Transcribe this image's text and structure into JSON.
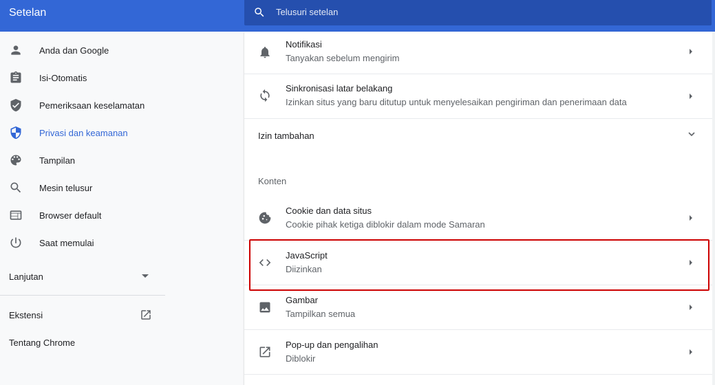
{
  "header": {
    "title": "Setelan",
    "search_placeholder": "Telusuri setelan"
  },
  "sidebar": {
    "items": [
      {
        "label": "Anda dan Google",
        "icon": "person-icon"
      },
      {
        "label": "Isi-Otomatis",
        "icon": "clipboard-icon"
      },
      {
        "label": "Pemeriksaan keselamatan",
        "icon": "shield-check-icon"
      },
      {
        "label": "Privasi dan keamanan",
        "icon": "shield-half-icon",
        "active": true
      },
      {
        "label": "Tampilan",
        "icon": "palette-icon"
      },
      {
        "label": "Mesin telusur",
        "icon": "search-icon"
      },
      {
        "label": "Browser default",
        "icon": "browser-window-icon"
      },
      {
        "label": "Saat memulai",
        "icon": "power-icon"
      }
    ],
    "advanced_label": "Lanjutan",
    "extensions_label": "Ekstensi",
    "about_label": "Tentang Chrome"
  },
  "main": {
    "rows_top": [
      {
        "title": "Notifikasi",
        "subtitle": "Tanyakan sebelum mengirim",
        "icon": "bell-icon"
      },
      {
        "title": "Sinkronisasi latar belakang",
        "subtitle": "Izinkan situs yang baru ditutup untuk menyelesaikan pengiriman dan penerimaan data",
        "icon": "sync-icon"
      }
    ],
    "additional_permissions_label": "Izin tambahan",
    "content_heading": "Konten",
    "content_rows": [
      {
        "title": "Cookie dan data situs",
        "subtitle": "Cookie pihak ketiga diblokir dalam mode Samaran",
        "icon": "cookie-icon"
      },
      {
        "title": "JavaScript",
        "subtitle": "Diizinkan",
        "icon": "code-brackets-icon"
      },
      {
        "title": "Gambar",
        "subtitle": "Tampilkan semua",
        "icon": "image-icon"
      },
      {
        "title": "Pop-up dan pengalihan",
        "subtitle": "Diblokir",
        "icon": "open-external-icon"
      }
    ]
  },
  "colors": {
    "header_bg": "#3367d6",
    "search_bg": "#254fae",
    "active_blue": "#3367d6",
    "highlight_red": "#cc0000"
  }
}
